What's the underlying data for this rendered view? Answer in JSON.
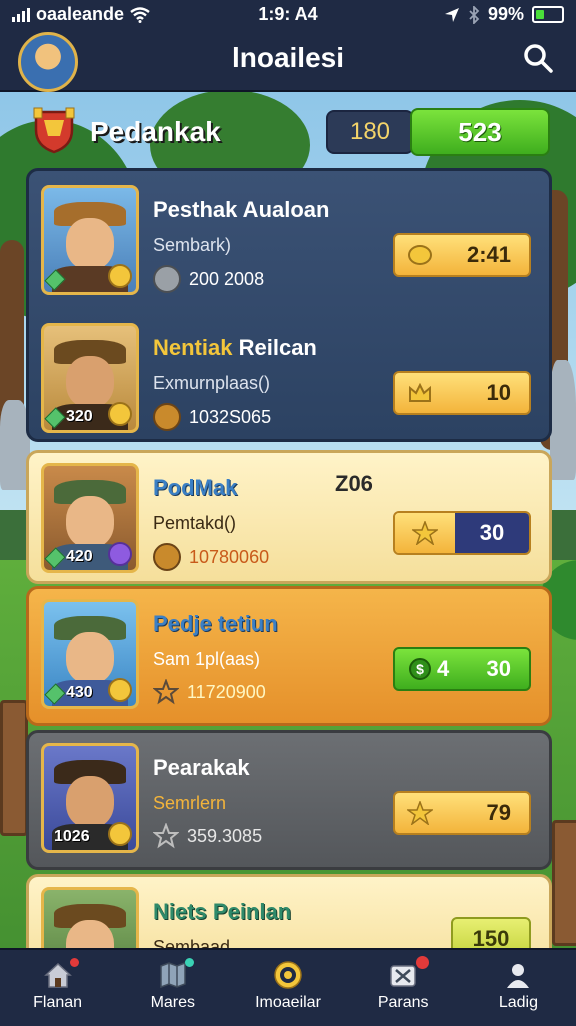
{
  "status_bar": {
    "carrier": "oaaleande",
    "time": "1:9: A4",
    "battery": "99%"
  },
  "header": {
    "title": "lnoailesi"
  },
  "section": {
    "title": "Pedankak",
    "stat_left": "180",
    "stat_right": "523"
  },
  "players": [
    {
      "name": "Pesthak Aualoan",
      "subtitle": "Sembark)",
      "score": "200 2008",
      "reward": "2:41",
      "reward_icon": "gold-coin-icon",
      "badge_number": ""
    },
    {
      "name_part1": "Nentiak",
      "name_part2": "Reilcan",
      "subtitle": "Exmurnplaas()",
      "score": "1032S065",
      "reward": "10",
      "reward_icon": "crown-icon",
      "badge_number": "320"
    },
    {
      "name": "PodMak",
      "rank": "Z06",
      "subtitle": "Pemtakd()",
      "score": "10780060",
      "reward": "30",
      "reward_icon": "star-icon",
      "badge_number": "420"
    },
    {
      "name": "Pedje tetiun",
      "subtitle": "Sam 1pl(aas)",
      "score": "11720900",
      "reward_left": "4",
      "reward": "30",
      "reward_icon": "dollar-coin-icon",
      "badge_number": "430"
    },
    {
      "name": "Pearakak",
      "subtitle": "Semrlern",
      "score": "359.3085",
      "reward": "79",
      "reward_icon": "star-icon",
      "badge_number": "1026"
    },
    {
      "name": "Niets Peinlan",
      "subtitle": "Sembaad",
      "score": "",
      "reward": "150",
      "reward_icon": "",
      "badge_number": ""
    }
  ],
  "bottom_nav": [
    {
      "label": "Flanan",
      "icon": "home-icon"
    },
    {
      "label": "Mares",
      "icon": "map-icon"
    },
    {
      "label": "Imoaeilar",
      "icon": "target-icon"
    },
    {
      "label": "Parans",
      "icon": "battle-icon"
    },
    {
      "label": "Ladig",
      "icon": "profile-icon"
    }
  ],
  "colors": {
    "header": "#1f2a44",
    "accent_green": "#3fae1e",
    "gold": "#f3b43b"
  }
}
